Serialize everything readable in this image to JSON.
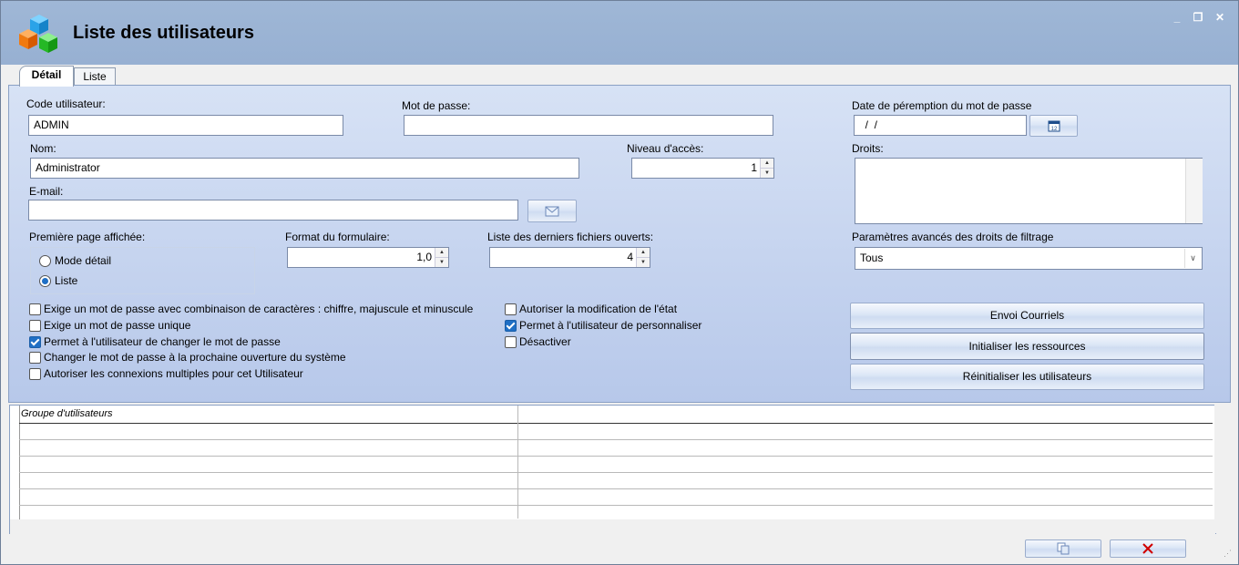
{
  "window": {
    "title": "Liste des utilisateurs",
    "controls": {
      "minimize": "_",
      "restore": "❐",
      "close": "✕"
    }
  },
  "tabs": [
    {
      "label": "Détail",
      "active": true
    },
    {
      "label": "Liste",
      "active": false
    }
  ],
  "form": {
    "user_code": {
      "label": "Code utilisateur:",
      "value": "ADMIN"
    },
    "password": {
      "label": "Mot de passe:",
      "value": ""
    },
    "password_expiry": {
      "label": "Date de péremption du mot de passe",
      "value": "  /  /"
    },
    "name": {
      "label": "Nom:",
      "value": "Administrator"
    },
    "access_level": {
      "label": "Niveau d'accès:",
      "value": "1"
    },
    "rights": {
      "label": "Droits:",
      "value": ""
    },
    "email": {
      "label": "E-mail:",
      "value": ""
    },
    "first_page": {
      "label": "Première page affichée:",
      "options": [
        {
          "label": "Mode détail",
          "selected": false
        },
        {
          "label": "Liste",
          "selected": true
        }
      ]
    },
    "form_format": {
      "label": "Format du formulaire:",
      "value": "1,0"
    },
    "recent_files": {
      "label": "Liste des derniers fichiers ouverts:",
      "value": "4"
    },
    "advanced_filter": {
      "label": "Paramètres avancés des droits de filtrage",
      "value": "Tous"
    }
  },
  "checkboxes_left": [
    {
      "label": "Exige un mot de passe avec combinaison de caractères : chiffre, majuscule et minuscule",
      "checked": false
    },
    {
      "label": "Exige un mot de passe unique",
      "checked": false
    },
    {
      "label": "Permet à l'utilisateur de changer le mot de passe",
      "checked": true
    },
    {
      "label": "Changer le mot de passe à la prochaine ouverture du système",
      "checked": false
    },
    {
      "label": "Autoriser les connexions multiples pour cet Utilisateur",
      "checked": false
    }
  ],
  "checkboxes_right": [
    {
      "label": "Autoriser la modification de l'état",
      "checked": false
    },
    {
      "label": "Permet à l'utilisateur de personnaliser",
      "checked": true
    },
    {
      "label": "Désactiver",
      "checked": false
    }
  ],
  "actions": {
    "send_emails": "Envoi Courriels",
    "init_resources": "Initialiser les ressources",
    "reset_users": "Réinitialiser les utilisateurs"
  },
  "grid": {
    "column_header": "Groupe d'utilisateurs",
    "rows": 6
  },
  "colors": {
    "titlebar": "#9fb7d6",
    "panel_top": "#d7e2f5",
    "panel_bottom": "#b7c8ea",
    "accent": "#1f6fc5",
    "close_icon": "#d00000"
  }
}
